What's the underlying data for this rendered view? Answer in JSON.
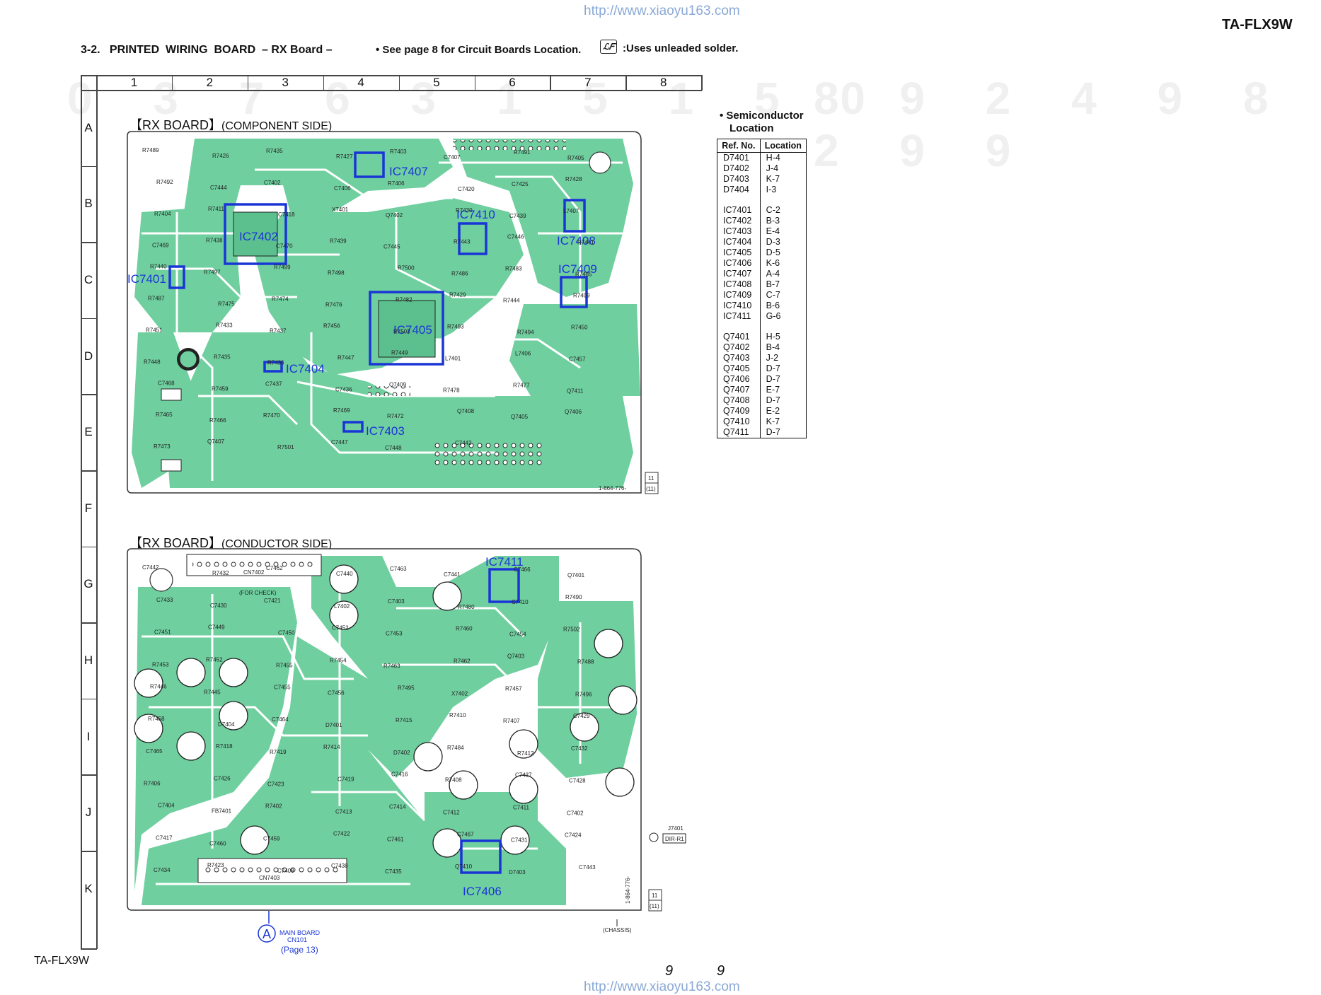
{
  "header": {
    "url_top": "http://www.xiaoyu163.com",
    "model_top_right": "TA-FLX9W",
    "section_title": "3-2.   PRINTED  WIRING  BOARD  – RX Board –",
    "note": "• See page 8 for Circuit Boards Location.",
    "solder_icon": "lead-free-icon",
    "solder_note": ":Uses unleaded solder."
  },
  "grid": {
    "columns": [
      "1",
      "2",
      "3",
      "4",
      "5",
      "6",
      "7",
      "8"
    ],
    "rows": [
      "A",
      "B",
      "C",
      "D",
      "E",
      "F",
      "G",
      "H",
      "I",
      "J",
      "K"
    ]
  },
  "component_side": {
    "title_bracket": "【RX BOARD】",
    "title_side": "(COMPONENT SIDE)",
    "part_number": "1-864-776-",
    "page_ref_top": "11",
    "page_ref_bottom": "(11)",
    "ic_labels": {
      "ic7401": "IC7401",
      "ic7402": "IC7402",
      "ic7403": "IC7403",
      "ic7404": "IC7404",
      "ic7405": "IC7405",
      "ic7407": "IC7407",
      "ic7408": "IC7408",
      "ic7409": "IC7409",
      "ic7410": "IC7410"
    },
    "refs": [
      "R7489",
      "R7426",
      "R7435",
      "R7427",
      "R7403",
      "C7407",
      "R7491",
      "R7405",
      "R7492",
      "C7444",
      "C7402",
      "C7406",
      "R7406",
      "C7420",
      "C7425",
      "R7428",
      "R7404",
      "R7411",
      "C7418",
      "X7401",
      "Q7402",
      "R7430",
      "C7439",
      "L7407",
      "C7469",
      "R7438",
      "C7470",
      "R7439",
      "C7445",
      "R7443",
      "C7446",
      "R7441",
      "R7440",
      "R7497",
      "R7499",
      "R7498",
      "R7500",
      "R7486",
      "R7483",
      "R7485",
      "R7487",
      "R7475",
      "R7474",
      "R7476",
      "R7482",
      "R7429",
      "R7444",
      "R7409",
      "R7451",
      "R7433",
      "R7437",
      "R7456",
      "R7503",
      "R7493",
      "R7494",
      "R7450",
      "R7448",
      "R7435",
      "R7436",
      "R7447",
      "R7449",
      "L7401",
      "L7406",
      "C7457",
      "C7468",
      "R7459",
      "C7437",
      "C7436",
      "Q7409",
      "R7478",
      "R7477",
      "Q7411",
      "R7465",
      "R7466",
      "R7470",
      "R7469",
      "R7472",
      "Q7408",
      "Q7405",
      "Q7406",
      "R7473",
      "Q7407",
      "R7501",
      "C7447",
      "C7448",
      "C7442"
    ]
  },
  "conductor_side": {
    "title_bracket": "【RX BOARD】",
    "title_side": "(CONDUCTOR SIDE)",
    "part_number": "1-864-776-",
    "page_ref_top": "11",
    "page_ref_bottom": "(11)",
    "cn7402": "CN7402",
    "cn7402_note": "(FOR CHECK)",
    "cn7403": "CN7403",
    "ic_labels": {
      "ic7406": "IC7406",
      "ic7411": "IC7411"
    },
    "jack": "J7401",
    "jack_label": "DIR-R1",
    "chassis": "(CHASSIS)",
    "connector_letter": "A",
    "connector_dest": "MAIN BOARD",
    "connector_cn": "CN101",
    "connector_page": "(Page 13)",
    "refs": [
      "C7442",
      "R7432",
      "C7462",
      "C7440",
      "C7463",
      "C7441",
      "C7466",
      "Q7401",
      "C7433",
      "C7430",
      "C7421",
      "L7402",
      "C7403",
      "R7480",
      "C7410",
      "R7490",
      "C7451",
      "C7449",
      "C7450",
      "C7452",
      "C7453",
      "R7460",
      "C7454",
      "R7502",
      "R7453",
      "R7452",
      "R7455",
      "R7454",
      "R7463",
      "R7462",
      "Q7403",
      "R7488",
      "R7446",
      "R7445",
      "C7455",
      "C7456",
      "R7495",
      "X7402",
      "R7457",
      "R7496",
      "R7458",
      "D7404",
      "C7464",
      "D7401",
      "R7415",
      "R7410",
      "R7407",
      "C7429",
      "C7465",
      "R7418",
      "R7419",
      "R7414",
      "D7402",
      "R7484",
      "R7412",
      "C7432",
      "R7406",
      "C7426",
      "C7423",
      "C7419",
      "C7416",
      "R7408",
      "C7427",
      "C7428",
      "C7404",
      "FB7401",
      "R7402",
      "C7413",
      "C7414",
      "C7412",
      "C7411",
      "C7402",
      "C7417",
      "C7460",
      "C7459",
      "C7422",
      "C7461",
      "C7467",
      "C7431",
      "C7424",
      "C7434",
      "R7423",
      "C7408",
      "C7438",
      "C7435",
      "Q7410",
      "D7403",
      "C7443"
    ]
  },
  "semiconductor_location": {
    "heading_line1": "•  Semiconductor",
    "heading_line2": "Location",
    "col_ref": "Ref. No.",
    "col_loc": "Location",
    "groups": [
      [
        [
          "D7401",
          "H-4"
        ],
        [
          "D7402",
          "J-4"
        ],
        [
          "D7403",
          "K-7"
        ],
        [
          "D7404",
          "I-3"
        ]
      ],
      [
        [
          "IC7401",
          "C-2"
        ],
        [
          "IC7402",
          "B-3"
        ],
        [
          "IC7403",
          "E-4"
        ],
        [
          "IC7404",
          "D-3"
        ],
        [
          "IC7405",
          "D-5"
        ],
        [
          "IC7406",
          "K-6"
        ],
        [
          "IC7407",
          "A-4"
        ],
        [
          "IC7408",
          "B-7"
        ],
        [
          "IC7409",
          "C-7"
        ],
        [
          "IC7410",
          "B-6"
        ],
        [
          "IC7411",
          "G-6"
        ]
      ],
      [
        [
          "Q7401",
          "H-5"
        ],
        [
          "Q7402",
          "B-4"
        ],
        [
          "Q7403",
          "J-2"
        ],
        [
          "Q7405",
          "D-7"
        ],
        [
          "Q7406",
          "D-7"
        ],
        [
          "Q7407",
          "E-7"
        ],
        [
          "Q7408",
          "D-7"
        ],
        [
          "Q7409",
          "E-2"
        ],
        [
          "Q7410",
          "K-7"
        ],
        [
          "Q7411",
          "D-7"
        ]
      ]
    ]
  },
  "footer": {
    "model_bottom_left": "TA-FLX9W",
    "page_left": "9",
    "page_right": "9",
    "url_bottom": "http://www.xiaoyu163.com"
  },
  "colors": {
    "board_green": "#6fcf9f",
    "trace_green": "#5cc08e",
    "ic_highlight": "#1a35d6",
    "url_color": "#8aa9d6"
  }
}
